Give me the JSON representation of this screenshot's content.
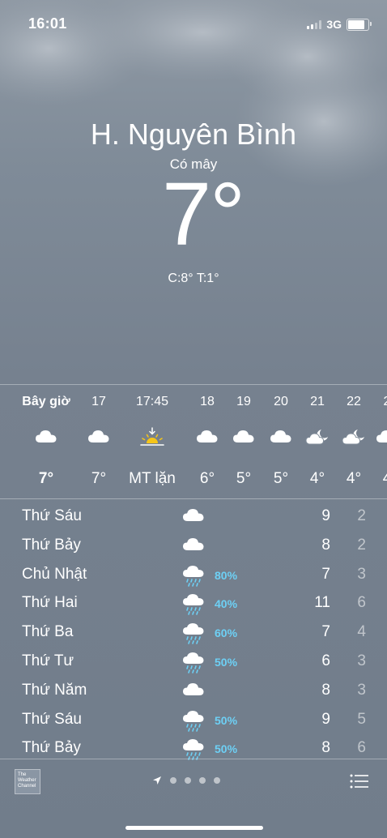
{
  "status": {
    "time": "16:01",
    "network": "3G",
    "battery_level": 0.85,
    "signal_bars": 2
  },
  "location": {
    "city": "H. Nguyên Bình",
    "condition": "Có mây",
    "temperature": "7°",
    "hi_lo": "C:8°  T:1°"
  },
  "hourly": [
    {
      "label": "Bây giờ",
      "icon": "cloud-icon",
      "temp": "7°",
      "bold": true
    },
    {
      "label": "17",
      "icon": "cloud-icon",
      "temp": "7°"
    },
    {
      "label": "17:45",
      "icon": "sunset-icon",
      "temp": "MT lặn"
    },
    {
      "label": "18",
      "icon": "cloud-icon",
      "temp": "6°"
    },
    {
      "label": "19",
      "icon": "cloud-icon",
      "temp": "5°"
    },
    {
      "label": "20",
      "icon": "cloud-icon",
      "temp": "5°"
    },
    {
      "label": "21",
      "icon": "cloud-moon-icon",
      "temp": "4°"
    },
    {
      "label": "22",
      "icon": "cloud-moon-icon",
      "temp": "4°"
    },
    {
      "label": "2",
      "icon": "cloud-icon",
      "temp": "4"
    }
  ],
  "daily": [
    {
      "day": "Thứ Sáu",
      "icon": "cloud-icon",
      "pop": "",
      "hi": "9",
      "lo": "2"
    },
    {
      "day": "Thứ Bảy",
      "icon": "cloud-icon",
      "pop": "",
      "hi": "8",
      "lo": "2"
    },
    {
      "day": "Chủ Nhật",
      "icon": "cloud-rain-icon",
      "pop": "80%",
      "hi": "7",
      "lo": "3"
    },
    {
      "day": "Thứ Hai",
      "icon": "cloud-rain-icon",
      "pop": "40%",
      "hi": "11",
      "lo": "6"
    },
    {
      "day": "Thứ Ba",
      "icon": "cloud-rain-icon",
      "pop": "60%",
      "hi": "7",
      "lo": "4"
    },
    {
      "day": "Thứ Tư",
      "icon": "cloud-rain-icon",
      "pop": "50%",
      "hi": "6",
      "lo": "3"
    },
    {
      "day": "Thứ Năm",
      "icon": "cloud-icon",
      "pop": "",
      "hi": "8",
      "lo": "3"
    },
    {
      "day": "Thứ Sáu",
      "icon": "cloud-rain-icon",
      "pop": "50%",
      "hi": "9",
      "lo": "5"
    },
    {
      "day": "Thứ Bảy",
      "icon": "cloud-rain-icon",
      "pop": "50%",
      "hi": "8",
      "lo": "6"
    }
  ],
  "footer": {
    "logo_text": "The Weather Channel",
    "page_count": 4
  },
  "colors": {
    "pop": "#6dd0f5",
    "sunset": "#f5c518"
  }
}
